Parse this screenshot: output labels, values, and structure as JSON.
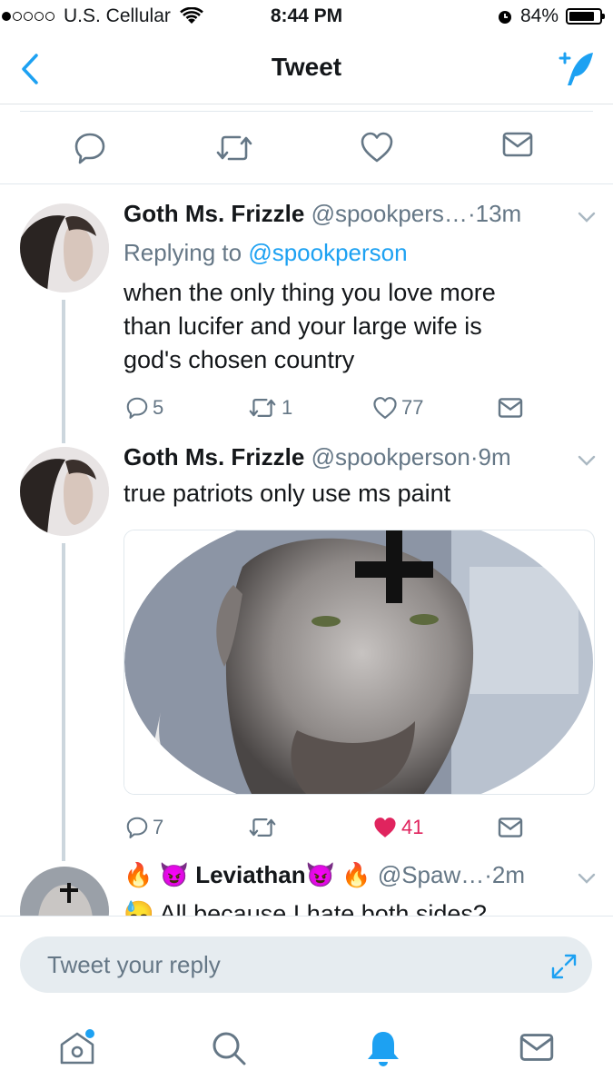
{
  "status": {
    "carrier": "U.S. Cellular",
    "time": "8:44 PM",
    "battery": "84%",
    "battery_level": 0.84
  },
  "nav": {
    "title": "Tweet"
  },
  "tweets": [
    {
      "name": "Goth Ms. Frizzle",
      "handle": "@spookpers…",
      "time": "13m",
      "replying_prefix": "Replying to",
      "replying_to": "@spookperson",
      "lines": [
        "when the only thing you love more",
        "than lucifer and your large wife is",
        "god's chosen country"
      ],
      "replies": "5",
      "retweets": "1",
      "likes": "77"
    },
    {
      "name": "Goth Ms. Frizzle",
      "handle": "@spookperson",
      "time": "9m",
      "lines": [
        "true patriots only use ms paint"
      ],
      "replies": "7",
      "retweets": "",
      "likes": "41",
      "liked": true
    },
    {
      "name": "Leviathan",
      "handle": "@Spaw…",
      "time": "2m",
      "lines": [
        "All because I hate both sides?"
      ]
    }
  ],
  "reply_bar": {
    "placeholder": "Tweet your reply"
  },
  "colors": {
    "accent": "#1da1f2",
    "like": "#e0245e",
    "muted": "#657786"
  },
  "icons": [
    "back-icon",
    "compose-icon",
    "reply-icon",
    "retweet-icon",
    "like-icon",
    "message-icon",
    "expand-icon",
    "home-icon",
    "search-icon",
    "notifications-icon"
  ]
}
